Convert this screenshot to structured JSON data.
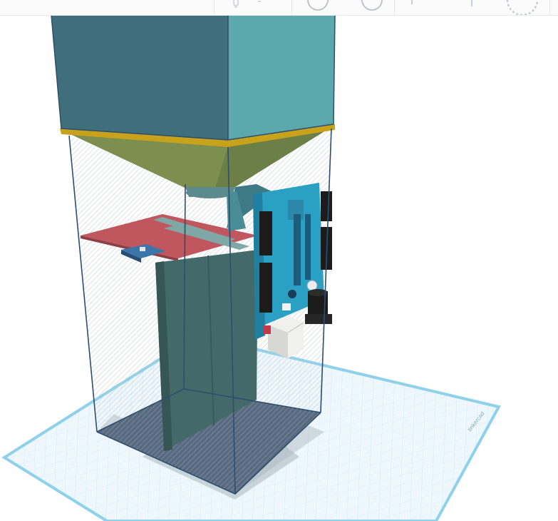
{
  "toolbar": {
    "buttons": [
      {
        "name": "light-bulb-button",
        "icon": "light-bulb-icon"
      },
      {
        "name": "undo-view-button",
        "icon": "circle-arrow-icon"
      },
      {
        "name": "redo-view-button",
        "icon": "circle-arrow-icon"
      },
      {
        "name": "ruler-button",
        "icon": "ruler-icon"
      },
      {
        "name": "pin-button",
        "icon": "pin-icon"
      },
      {
        "name": "spinner-button",
        "icon": "dotted-circle-icon"
      }
    ]
  },
  "workplane": {
    "watermark": "tinkercad",
    "grid_color": "#bfe3f1",
    "edge_color": "#8fd0ea"
  },
  "colors": {
    "hopper_teal": "#5ba8ad",
    "hopper_dark": "#3f6f7a",
    "funnel": "#6b7f47",
    "rim": "#c9a21c",
    "tray": "#c0575e",
    "wall": "#436a69",
    "board": "#2aa0c4",
    "enclosure_edge": "#2f4d6e"
  }
}
